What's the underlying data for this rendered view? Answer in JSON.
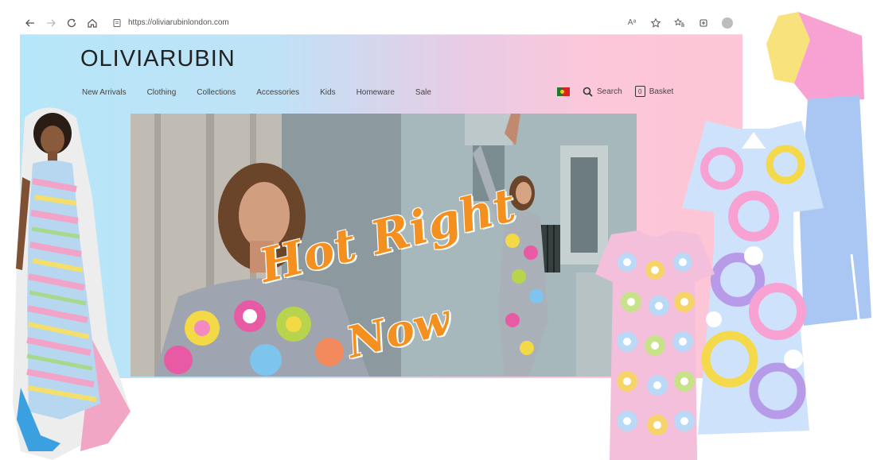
{
  "browser": {
    "url": "https://oliviarubinlondon.com",
    "read_aloud_label": "Aᵃ",
    "icons": [
      "back-arrow-icon",
      "forward-arrow-icon",
      "refresh-icon",
      "home-icon",
      "site-info-icon",
      "read-aloud-icon",
      "favorite-star-icon",
      "favorites-list-icon",
      "collections-icon",
      "profile-avatar-icon"
    ]
  },
  "site": {
    "logo": {
      "part1": "OLIVIA",
      "part2": "RUBIN"
    },
    "menu": [
      {
        "label": "New Arrivals"
      },
      {
        "label": "Clothing"
      },
      {
        "label": "Collections"
      },
      {
        "label": "Accessories"
      },
      {
        "label": "Kids"
      },
      {
        "label": "Homeware"
      },
      {
        "label": "Sale"
      }
    ],
    "search_label": "Search",
    "basket_label": "Basket",
    "basket_count": "0",
    "hero": {
      "headline_line1": "Hot Right",
      "headline_line2": "Now"
    }
  },
  "colors": {
    "gradient_left": "#b6e6f9",
    "gradient_right": "#fdc6d6",
    "headline": "#f4901f"
  }
}
